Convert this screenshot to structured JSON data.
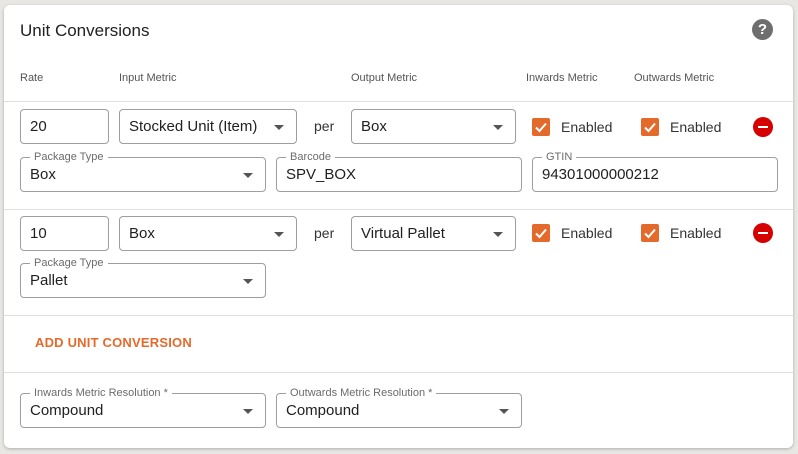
{
  "header": {
    "title": "Unit Conversions",
    "help_icon": "question-circle-icon",
    "help_glyph": "?"
  },
  "columns": {
    "rate": "Rate",
    "input_metric": "Input Metric",
    "output_metric": "Output Metric",
    "inwards_metric": "Inwards Metric",
    "outwards_metric": "Outwards Metric"
  },
  "conversions": [
    {
      "rate": "20",
      "input_metric": "Stocked Unit (Item)",
      "per_label": "per",
      "output_metric": "Box",
      "inwards_enabled": true,
      "inwards_label": "Enabled",
      "outwards_enabled": true,
      "outwards_label": "Enabled",
      "package_type_label": "Package Type",
      "package_type": "Box",
      "barcode_label": "Barcode",
      "barcode": "SPV_BOX",
      "gtin_label": "GTIN",
      "gtin": "94301000000212"
    },
    {
      "rate": "10",
      "input_metric": "Box",
      "per_label": "per",
      "output_metric": "Virtual Pallet",
      "inwards_enabled": true,
      "inwards_label": "Enabled",
      "outwards_enabled": true,
      "outwards_label": "Enabled",
      "package_type_label": "Package Type",
      "package_type": "Pallet"
    }
  ],
  "add_button_label": "ADD UNIT CONVERSION",
  "resolution": {
    "inwards_label": "Inwards Metric Resolution *",
    "inwards_value": "Compound",
    "outwards_label": "Outwards Metric Resolution *",
    "outwards_value": "Compound"
  },
  "colors": {
    "accent": "#e46a2b",
    "remove": "#d50000"
  }
}
